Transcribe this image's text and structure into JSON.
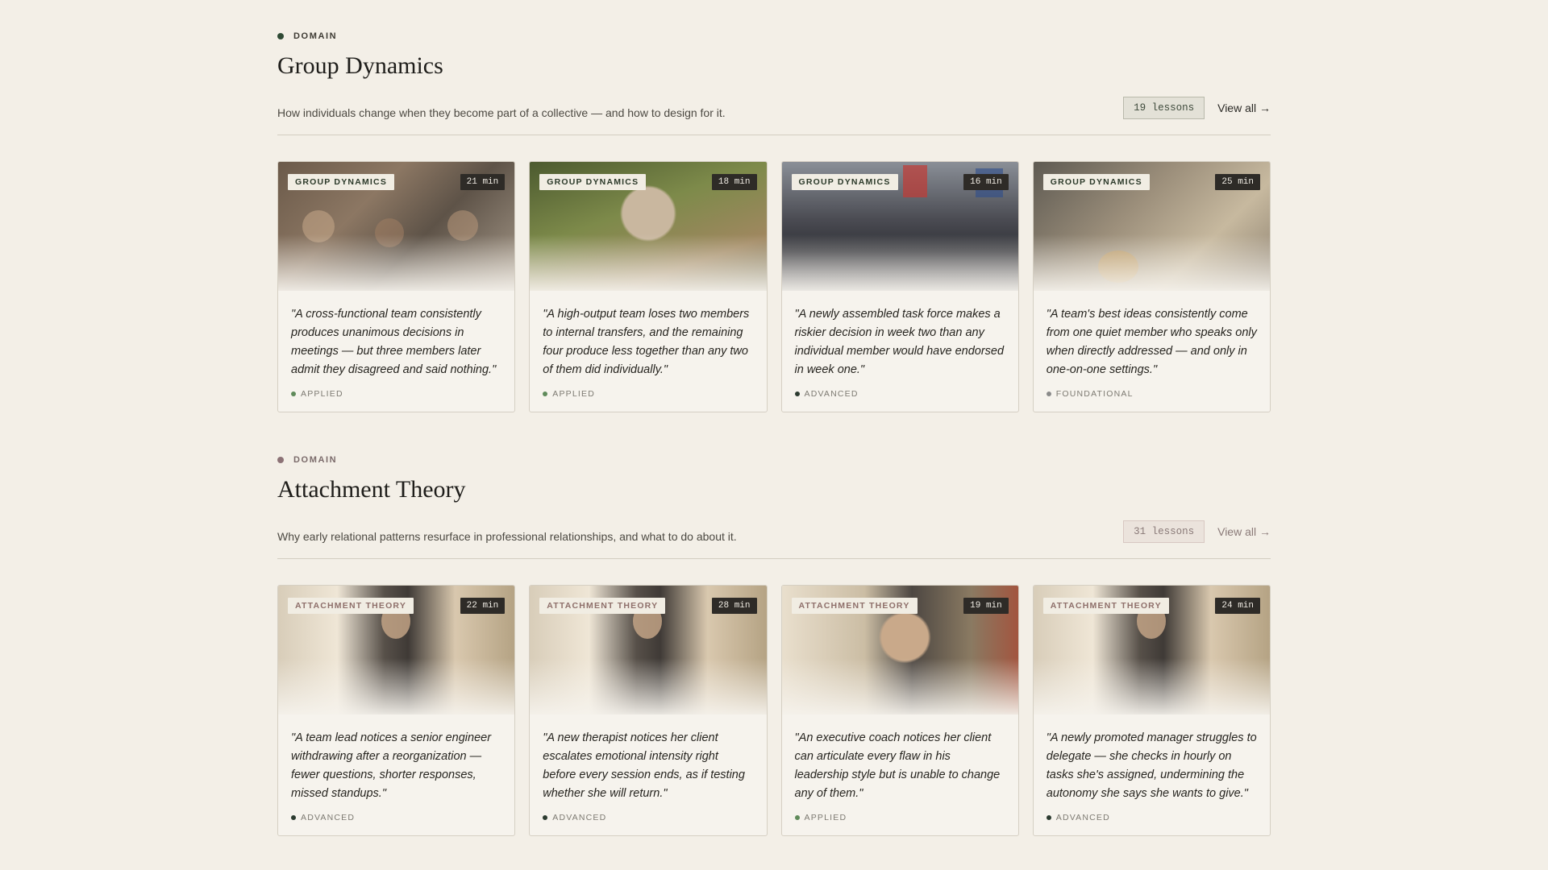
{
  "sections": [
    {
      "eyebrow": "DOMAIN",
      "dot_color": "#2f4a35",
      "title": "Group Dynamics",
      "description": "How individuals change when they become part of a collective — and how to design for it.",
      "count": "19 lessons",
      "view_all": "View all →",
      "cards": [
        {
          "tag": "GROUP DYNAMICS",
          "duration": "21 min",
          "quote": "\"A cross-functional team consistently produces unanimous decisions in meetings — but three members later admit they disagreed and said nothing.\"",
          "level": "APPLIED",
          "level_color": "#5f8a5a"
        },
        {
          "tag": "GROUP DYNAMICS",
          "duration": "18 min",
          "quote": "\"A high-output team loses two members to internal transfers, and the remaining four produce less together than any two of them did individually.\"",
          "level": "APPLIED",
          "level_color": "#5f8a5a"
        },
        {
          "tag": "GROUP DYNAMICS",
          "duration": "16 min",
          "quote": "\"A newly assembled task force makes a riskier decision in week two than any individual member would have endorsed in week one.\"",
          "level": "ADVANCED",
          "level_color": "#2c3b30"
        },
        {
          "tag": "GROUP DYNAMICS",
          "duration": "25 min",
          "quote": "\"A team's best ideas consistently come from one quiet member who speaks only when directly addressed — and only in one-on-one settings.\"",
          "level": "FOUNDATIONAL",
          "level_color": "#8a8a8a"
        }
      ]
    },
    {
      "eyebrow": "DOMAIN",
      "dot_color": "#8c7276",
      "title": "Attachment Theory",
      "description": "Why early relational patterns resurface in professional relationships, and what to do about it.",
      "count": "31 lessons",
      "view_all": "View all →",
      "cards": [
        {
          "tag": "ATTACHMENT THEORY",
          "duration": "22 min",
          "quote": "\"A team lead notices a senior engineer withdrawing after a reorganization — fewer questions, shorter responses, missed standups.\"",
          "level": "ADVANCED",
          "level_color": "#2c3b30"
        },
        {
          "tag": "ATTACHMENT THEORY",
          "duration": "28 min",
          "quote": "\"A new therapist notices her client escalates emotional intensity right before every session ends, as if testing whether she will return.\"",
          "level": "ADVANCED",
          "level_color": "#2c3b30"
        },
        {
          "tag": "ATTACHMENT THEORY",
          "duration": "19 min",
          "quote": "\"An executive coach notices her client can articulate every flaw in his leadership style but is unable to change any of them.\"",
          "level": "APPLIED",
          "level_color": "#5f8a5a"
        },
        {
          "tag": "ATTACHMENT THEORY",
          "duration": "24 min",
          "quote": "\"A newly promoted manager struggles to delegate — she checks in hourly on tasks she's assigned, undermining the autonomy she says she wants to give.\"",
          "level": "ADVANCED",
          "level_color": "#2c3b30"
        }
      ]
    }
  ]
}
